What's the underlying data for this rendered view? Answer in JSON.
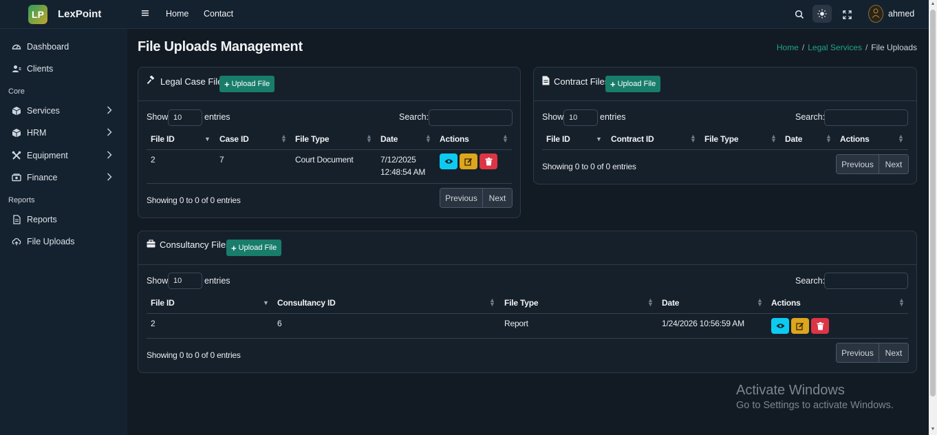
{
  "brand": {
    "logo": "LP",
    "name": "LexPoint"
  },
  "sidebar": {
    "items": [
      {
        "label": "Dashboard",
        "icon": "dashboard-icon"
      },
      {
        "label": "Clients",
        "icon": "users-icon"
      },
      {
        "label": "Services",
        "icon": "box-icon"
      },
      {
        "label": "HRM",
        "icon": "box-icon"
      },
      {
        "label": "Equipment",
        "icon": "tools-icon"
      },
      {
        "label": "Finance",
        "icon": "money-icon"
      },
      {
        "label": "Reports",
        "icon": "report-icon"
      },
      {
        "label": "File Uploads",
        "icon": "cloud-upload-icon"
      }
    ],
    "headers": {
      "core": "Core",
      "reports": "Reports"
    }
  },
  "topbar": {
    "home": "Home",
    "contact": "Contact",
    "user": "ahmed"
  },
  "page": {
    "title": "File Uploads Management",
    "breadcrumb": {
      "home": "Home",
      "section": "Legal Services",
      "current": "File Uploads"
    }
  },
  "common": {
    "show": "Show",
    "entries": "entries",
    "search": "Search:",
    "length": "10",
    "upload": "Upload File",
    "previous": "Previous",
    "next": "Next",
    "info": "Showing 0 to 0 of 0 entries"
  },
  "legal": {
    "title": "Legal Case Files",
    "columns": [
      "File ID",
      "Case ID",
      "File Type",
      "Date",
      "Actions"
    ],
    "rows": [
      {
        "file_id": "2",
        "case_id": "7",
        "type": "Court Document",
        "date_line1": "7/12/2025",
        "date_line2": "12:48:54 AM"
      }
    ]
  },
  "contract": {
    "title": "Contract Files",
    "columns": [
      "File ID",
      "Contract ID",
      "File Type",
      "Date",
      "Actions"
    ]
  },
  "consultancy": {
    "title": "Consultancy Files",
    "columns": [
      "File ID",
      "Consultancy ID",
      "File Type",
      "Date",
      "Actions"
    ],
    "rows": [
      {
        "file_id": "2",
        "consultancy_id": "6",
        "type": "Report",
        "date": "1/24/2026 10:56:59 AM"
      }
    ]
  },
  "watermark": {
    "line1": "Activate Windows",
    "line2": "Go to Settings to activate Windows."
  },
  "colors": {
    "accent": "#187d6a",
    "view": "#0dcaf0",
    "edit": "#dca61d",
    "delete": "#dc3545",
    "link": "#20a58a"
  }
}
